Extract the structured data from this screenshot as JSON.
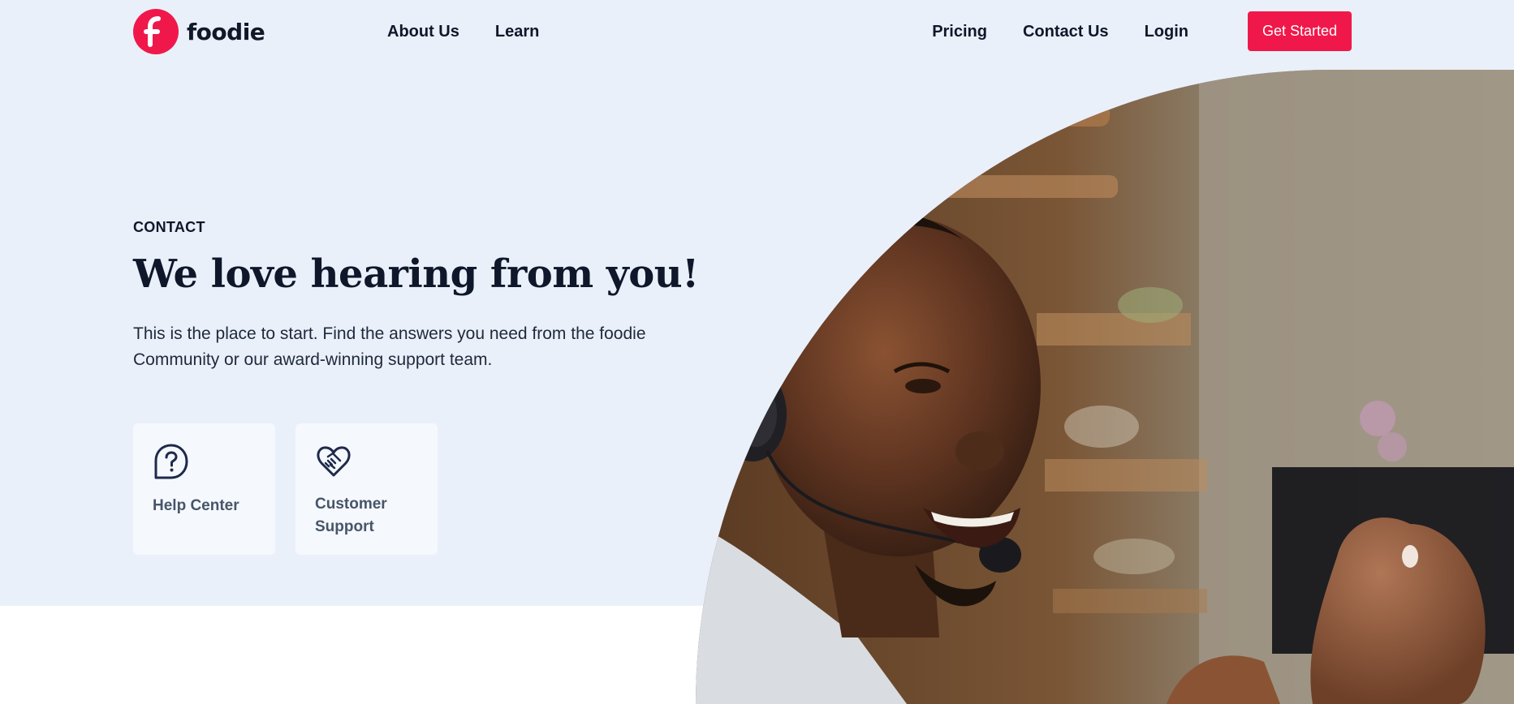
{
  "brand": {
    "name": "foodie",
    "logo_icon": "foodie-f-logo-icon",
    "accent": "#f0184a"
  },
  "nav": {
    "left": [
      {
        "label": "About Us"
      },
      {
        "label": "Learn"
      }
    ],
    "right": [
      {
        "label": "Pricing"
      },
      {
        "label": "Contact Us"
      },
      {
        "label": "Login"
      }
    ],
    "cta_label": "Get Started"
  },
  "hero": {
    "eyebrow": "CONTACT",
    "title": "We love hearing from you!",
    "description": "This is the place to start. Find the answers you need from the foodie Community or our award-winning support team.",
    "cards": [
      {
        "icon": "question-bubble-icon",
        "label": "Help Center"
      },
      {
        "icon": "heart-handshake-icon",
        "label": "Customer Support"
      }
    ],
    "image_subject": "smiling support agent wearing a headset"
  },
  "colors": {
    "hero_background": "#eaf0fa",
    "card_background": "#f5f8fd",
    "text_dark": "#0f172a",
    "icon_navy": "#1e2a4a"
  }
}
